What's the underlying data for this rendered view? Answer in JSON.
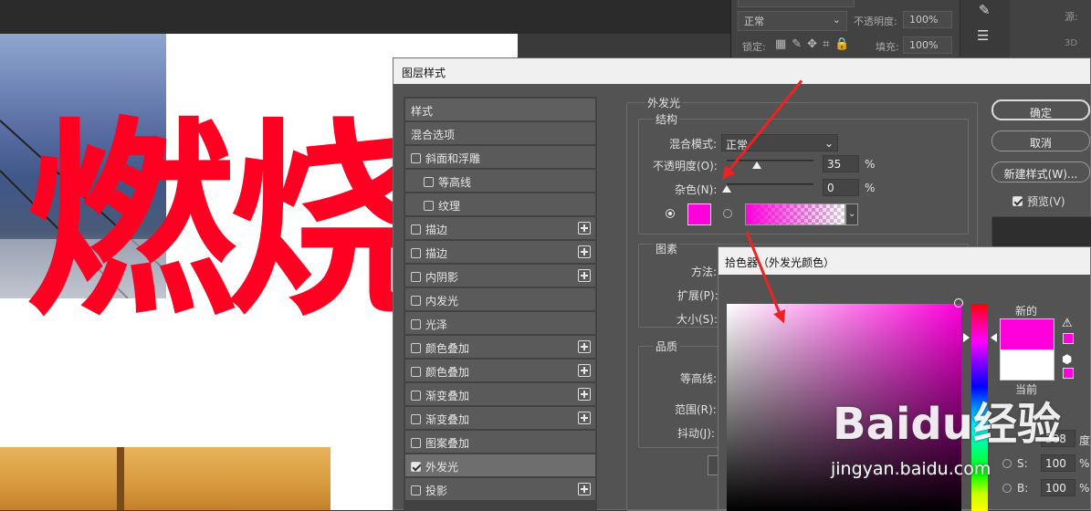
{
  "canvas": {
    "text": "燃烧"
  },
  "top_panel": {
    "blend_mode": "正常",
    "opacity_label": "不透明度:",
    "opacity_value": "100%",
    "lock_label": "锁定:",
    "fill_label": "填充:",
    "fill_value": "100%",
    "source_label": "源:",
    "threed_label": "3D"
  },
  "dialog": {
    "title": "图层样式",
    "styles_header": "样式",
    "items": [
      {
        "label": "混合选项"
      },
      {
        "label": "斜面和浮雕",
        "checked": false
      },
      {
        "label": "等高线",
        "checked": false
      },
      {
        "label": "纹理",
        "checked": false
      },
      {
        "label": "描边",
        "checked": false
      },
      {
        "label": "描边",
        "checked": false
      },
      {
        "label": "内阴影",
        "checked": false
      },
      {
        "label": "内发光",
        "checked": false
      },
      {
        "label": "光泽",
        "checked": false
      },
      {
        "label": "颜色叠加",
        "checked": false
      },
      {
        "label": "颜色叠加",
        "checked": false
      },
      {
        "label": "渐变叠加",
        "checked": false
      },
      {
        "label": "渐变叠加",
        "checked": false
      },
      {
        "label": "图案叠加",
        "checked": false
      },
      {
        "label": "外发光",
        "checked": true
      },
      {
        "label": "投影",
        "checked": false
      }
    ],
    "outer_glow": {
      "title": "外发光",
      "structure_title": "结构",
      "blend_mode_label": "混合模式:",
      "blend_mode_value": "正常",
      "opacity_label": "不透明度(O):",
      "opacity_value": "35",
      "opacity_level": 0.35,
      "noise_label": "杂色(N):",
      "noise_value": "0",
      "noise_level": 0,
      "percent": "%",
      "glow_color": "#ff00dd",
      "elements_title": "图素",
      "method_label": "方法:",
      "spread_label": "扩展(P):",
      "size_label": "大小(S):",
      "quality_title": "品质",
      "contour_label": "等高线:",
      "range_label": "范围(R):",
      "jitter_label": "抖动(J):"
    },
    "buttons": {
      "ok": "确定",
      "cancel": "取消",
      "new_style": "新建样式(W)...",
      "preview_label": "预览(V)"
    }
  },
  "color_picker": {
    "title": "拾色器（外发光颜色）",
    "new_label": "新的",
    "current_label": "当前",
    "new_color": "#ff00dd",
    "current_color": "#ffffff",
    "h_value": "308",
    "h_unit": "度",
    "s_label": "S:",
    "s_value": "100",
    "s_unit": "%",
    "b_label": "B:",
    "b_value": "100",
    "b_unit": "%"
  },
  "watermark": {
    "text": "Baidu经验",
    "url_text": "jingyan.baidu.com"
  }
}
